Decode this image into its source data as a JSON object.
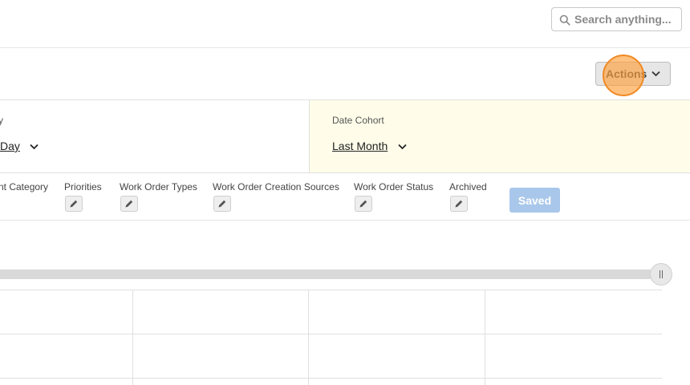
{
  "header": {
    "search": {
      "placeholder": "Search anything...",
      "value": ""
    }
  },
  "toolbar": {
    "actions_label": "Actions"
  },
  "filters": {
    "left": {
      "label_partial": "y",
      "value_partial": "Day"
    },
    "date_cohort": {
      "label": "Date Cohort",
      "value": "Last Month"
    }
  },
  "columns": [
    {
      "label": "nt Category"
    },
    {
      "label": "Priorities"
    },
    {
      "label": "Work Order Types"
    },
    {
      "label": "Work Order Creation Sources"
    },
    {
      "label": "Work Order Status"
    },
    {
      "label": "Archived"
    }
  ],
  "saved_label": "Saved",
  "colors": {
    "accent_click": "#f08a24",
    "saved_button": "#a9c7ea",
    "date_cohort_bg": "#fffde9"
  },
  "icons": {
    "search": "search-icon",
    "chevron": "chevron-down-icon",
    "edit": "pencil-icon"
  }
}
